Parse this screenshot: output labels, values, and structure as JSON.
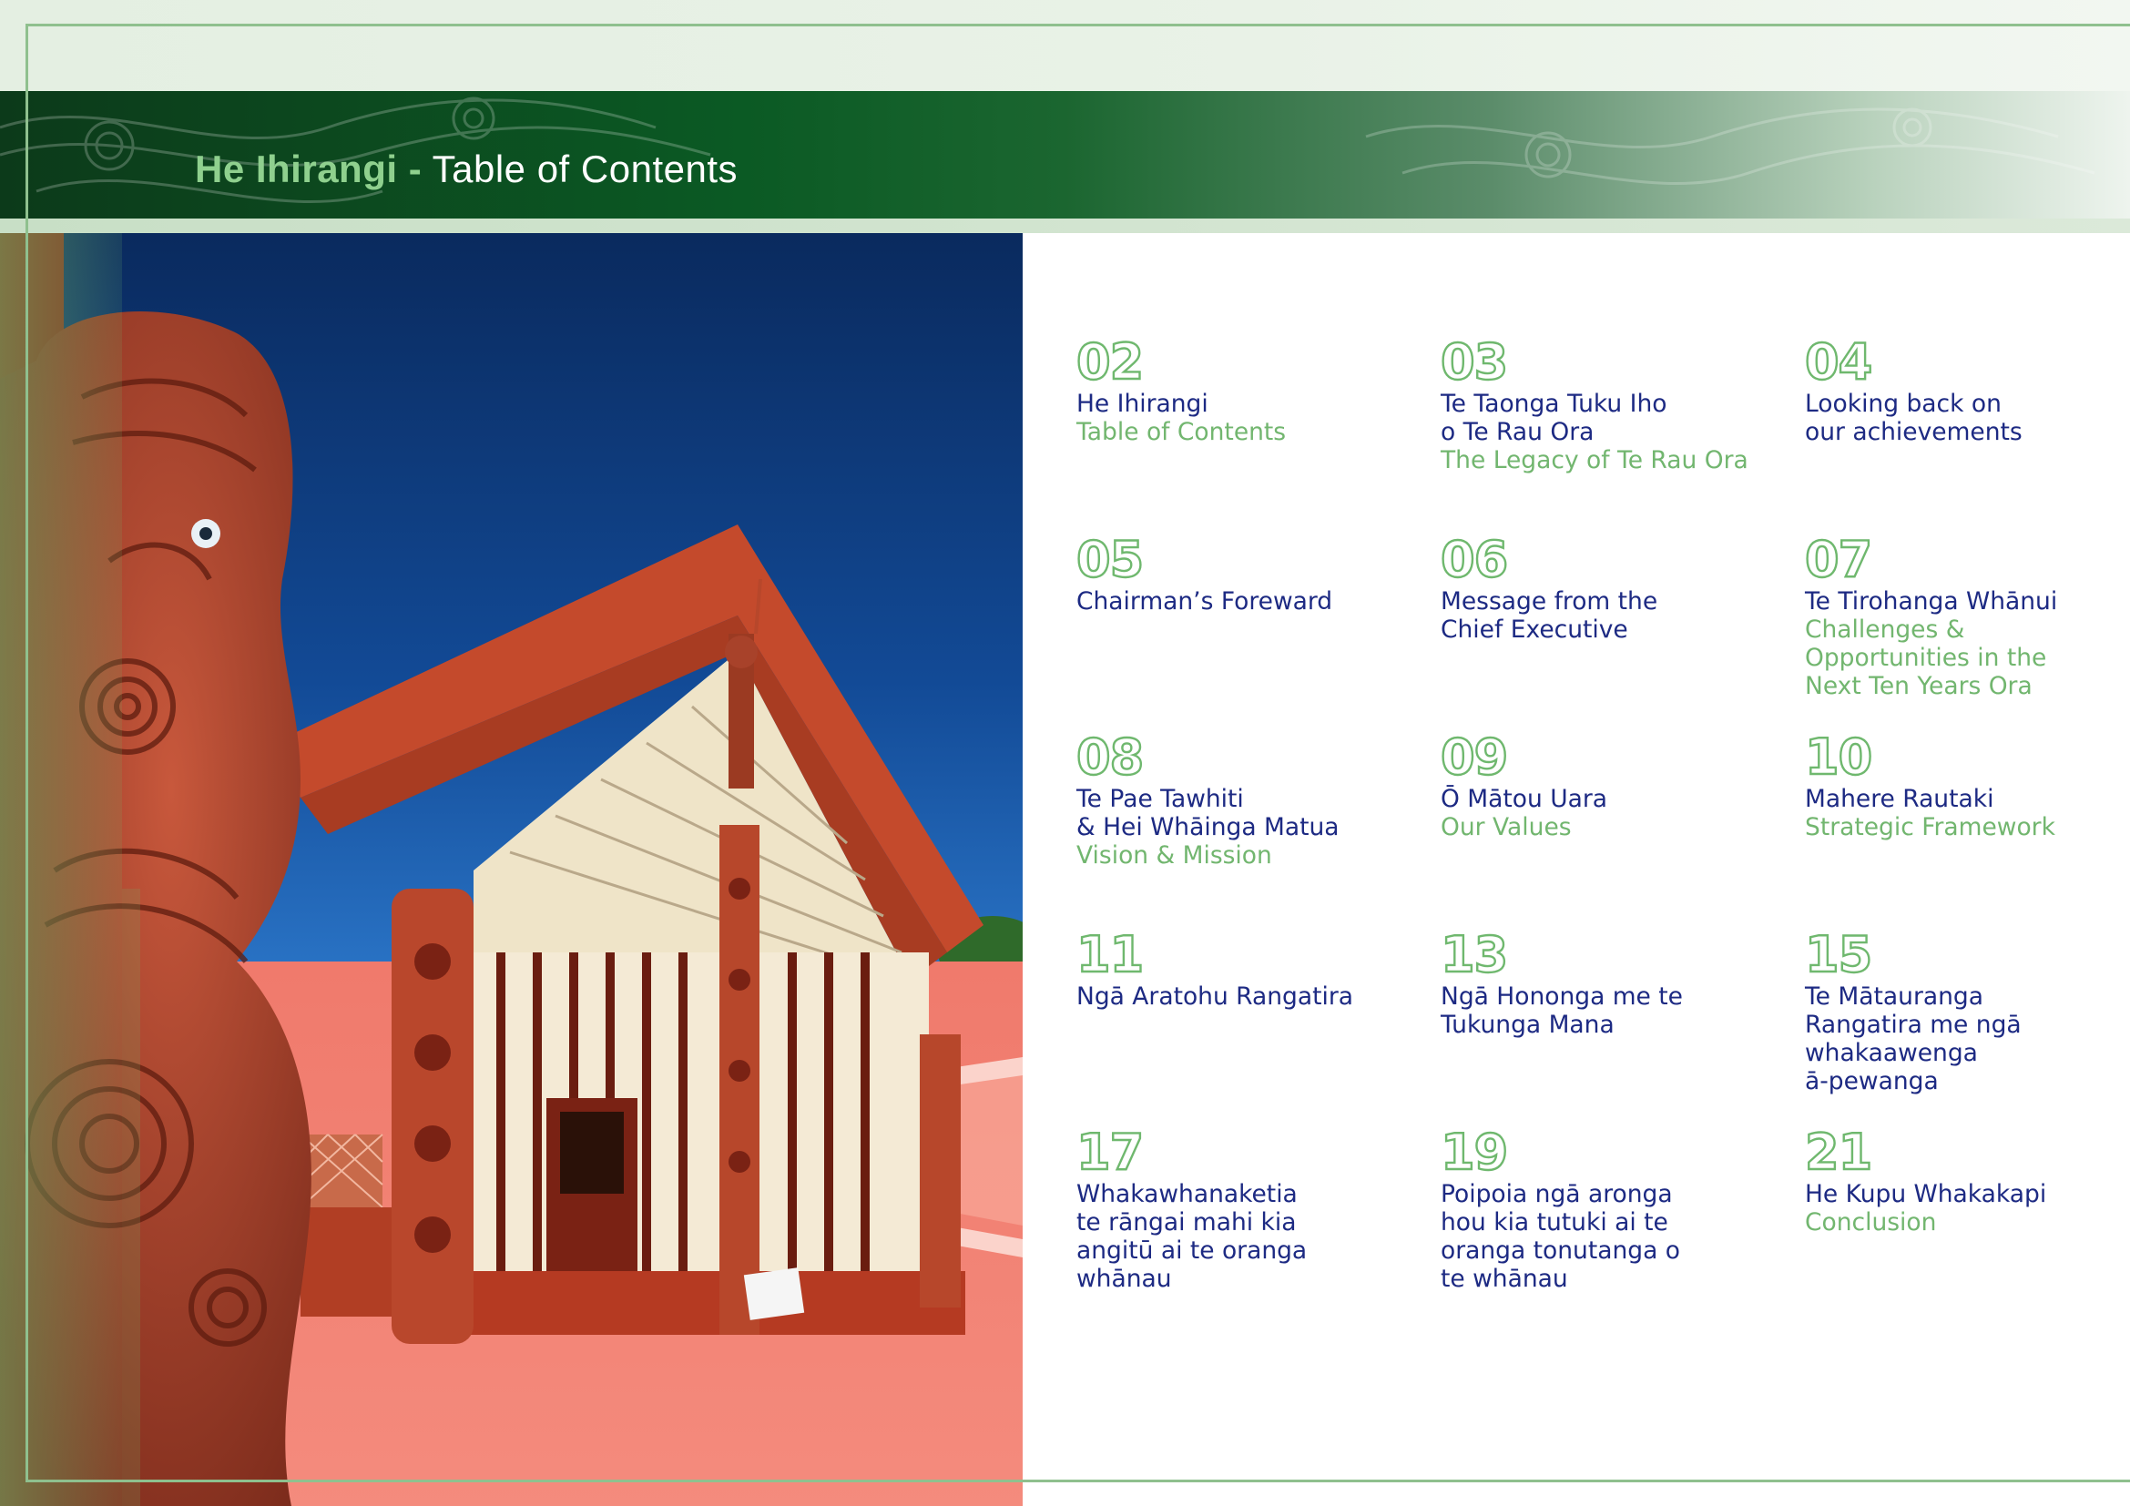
{
  "header": {
    "title_maori": "He Ihirangi -",
    "title_english": "Table of Contents"
  },
  "colors": {
    "accent_green": "#72b66f",
    "title_navy": "#1d2a83",
    "banner_dark_green": "#0b5a24"
  },
  "toc": [
    {
      "number": "02",
      "title": "He Ihirangi",
      "subtitle": "Table of Contents"
    },
    {
      "number": "03",
      "title": "Te Taonga Tuku Iho\no Te Rau Ora",
      "subtitle": "The Legacy of Te Rau Ora"
    },
    {
      "number": "04",
      "title": "Looking back on\nour achievements",
      "subtitle": ""
    },
    {
      "number": "05",
      "title": "Chairman’s Foreward",
      "subtitle": ""
    },
    {
      "number": "06",
      "title": "Message from the\nChief Executive",
      "subtitle": ""
    },
    {
      "number": "07",
      "title": "Te Tirohanga Whānui",
      "subtitle": "Challenges &\nOpportunities in the\nNext Ten Years Ora"
    },
    {
      "number": "08",
      "title": "Te Pae Tawhiti\n& Hei Whāinga Matua",
      "subtitle": "Vision & Mission"
    },
    {
      "number": "09",
      "title": "Ō Mātou Uara",
      "subtitle": "Our Values"
    },
    {
      "number": "10",
      "title": "Mahere Rautaki",
      "subtitle": "Strategic Framework"
    },
    {
      "number": "11",
      "title": "Ngā Aratohu Rangatira",
      "subtitle": ""
    },
    {
      "number": "13",
      "title": "Ngā Hononga me te\nTukunga Mana",
      "subtitle": ""
    },
    {
      "number": "15",
      "title": "Te Mātauranga\nRangatira me ngā\nwhakaawenga\nā-pewanga",
      "subtitle": ""
    },
    {
      "number": "17",
      "title": "Whakawhanaketia\nte rāngai mahi kia\nangitū ai te oranga\nwhānau",
      "subtitle": ""
    },
    {
      "number": "19",
      "title": "Poipoia ngā aronga\nhou kia tutuki ai te\noranga tonutanga o\nte whānau",
      "subtitle": ""
    },
    {
      "number": "21",
      "title": "He Kupu Whakakapi",
      "subtitle": "Conclusion"
    }
  ]
}
